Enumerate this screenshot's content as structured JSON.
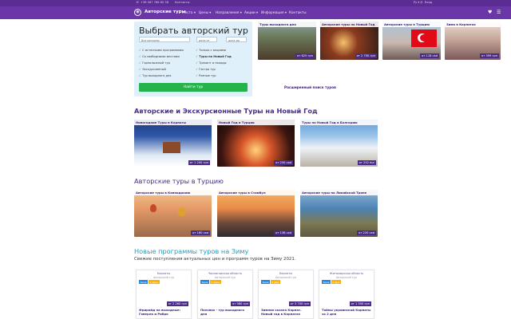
{
  "topbar": {
    "phone": "+38 067 788 80 58",
    "contacts": "Контакты",
    "lang": "Ру ▾",
    "login": "Вход"
  },
  "nav": {
    "brand": "Авторские туры",
    "items": [
      "Места",
      "Цены",
      "Направления",
      "Акции",
      "Информация",
      "Контакты"
    ],
    "chevron": "chevron-down-icon"
  },
  "search": {
    "title": "Выбрать авторский тур",
    "region_placeholder": "Все регионы",
    "date_from": "дата от",
    "date_to": "дата до",
    "options_left": [
      "С источными программами",
      "Со свободными местами",
      "Горнолыжный тур",
      "Экскурсионный",
      "Тур выходного дня"
    ],
    "options_right": [
      "Только с акциями",
      "Туры на Новый Год",
      "Трекинг и походы",
      "Гастро тур",
      "Разные тур"
    ],
    "button": "Найти тур",
    "advanced": "Расширенный поиск туров"
  },
  "featured": [
    {
      "title": "Туры выходного дня",
      "price": "от 625 грн"
    },
    {
      "title": "Авторские туры на Новый Год",
      "price": "от 2 700 грн"
    },
    {
      "title": "Авторские туры в Турцию",
      "price": "от 118 usd"
    },
    {
      "title": "Зима в Карпатах",
      "price": "от 399 грн"
    }
  ],
  "sections": {
    "newyear": "Авторские и Экскурсионные Туры на Новый Год",
    "turkey": "Авторские туры в Турцию",
    "winter": "Новые программы туров на Зиму",
    "winter_sub": "Свежие поступления актуальных цен и программ туров на Зиму 2021."
  },
  "newyear_cards": [
    {
      "title": "Новогодние Туры в Карпаты",
      "price": "от 1 200 грн"
    },
    {
      "title": "Новый Год в Турции",
      "price": "от 250 usd"
    },
    {
      "title": "Туры на Новый Год в Болгарию",
      "price": "от 252 eur"
    }
  ],
  "turkey_cards": [
    {
      "title": "Авторские туры в Каппадокию",
      "price": "от 160 usd"
    },
    {
      "title": "Авторские туры в Стамбул",
      "price": "от 138 usd"
    },
    {
      "title": "Авторские туры по Ликийской Тропе",
      "price": "от 220 usd"
    }
  ],
  "programs": [
    {
      "region": "Карпаты",
      "type": "Авторский тур",
      "tag1": "Зима",
      "tag2": "1 день",
      "price": "от 2 260 грн",
      "title": "Фрирайд на выходные: Говерла и Рибра"
    },
    {
      "region": "Черниговская область",
      "type": "Авторский тур",
      "tag1": "Зима",
      "tag2": "1 день",
      "price": "от 980 грн",
      "title": "Полсвах - тур выходного дня"
    },
    {
      "region": "Карпаты",
      "type": "Авторский тур",
      "tag1": "Зима",
      "tag2": "4 дня",
      "price": "от 3 700 грн",
      "title": "Зимняя сказка Карпат. Новый год в Карпатах"
    },
    {
      "region": "Житомирская область",
      "type": "Авторский тур",
      "tag1": "Зима",
      "tag2": "2 дня",
      "price": "от 1 550 грн",
      "title": "Тайны украинской Карпаты за 2 дня"
    }
  ],
  "colors": {
    "brand": "#6a36a8",
    "topbar": "#5b2c91",
    "accent_green": "#25b34b",
    "heading": "#4a2c88"
  }
}
